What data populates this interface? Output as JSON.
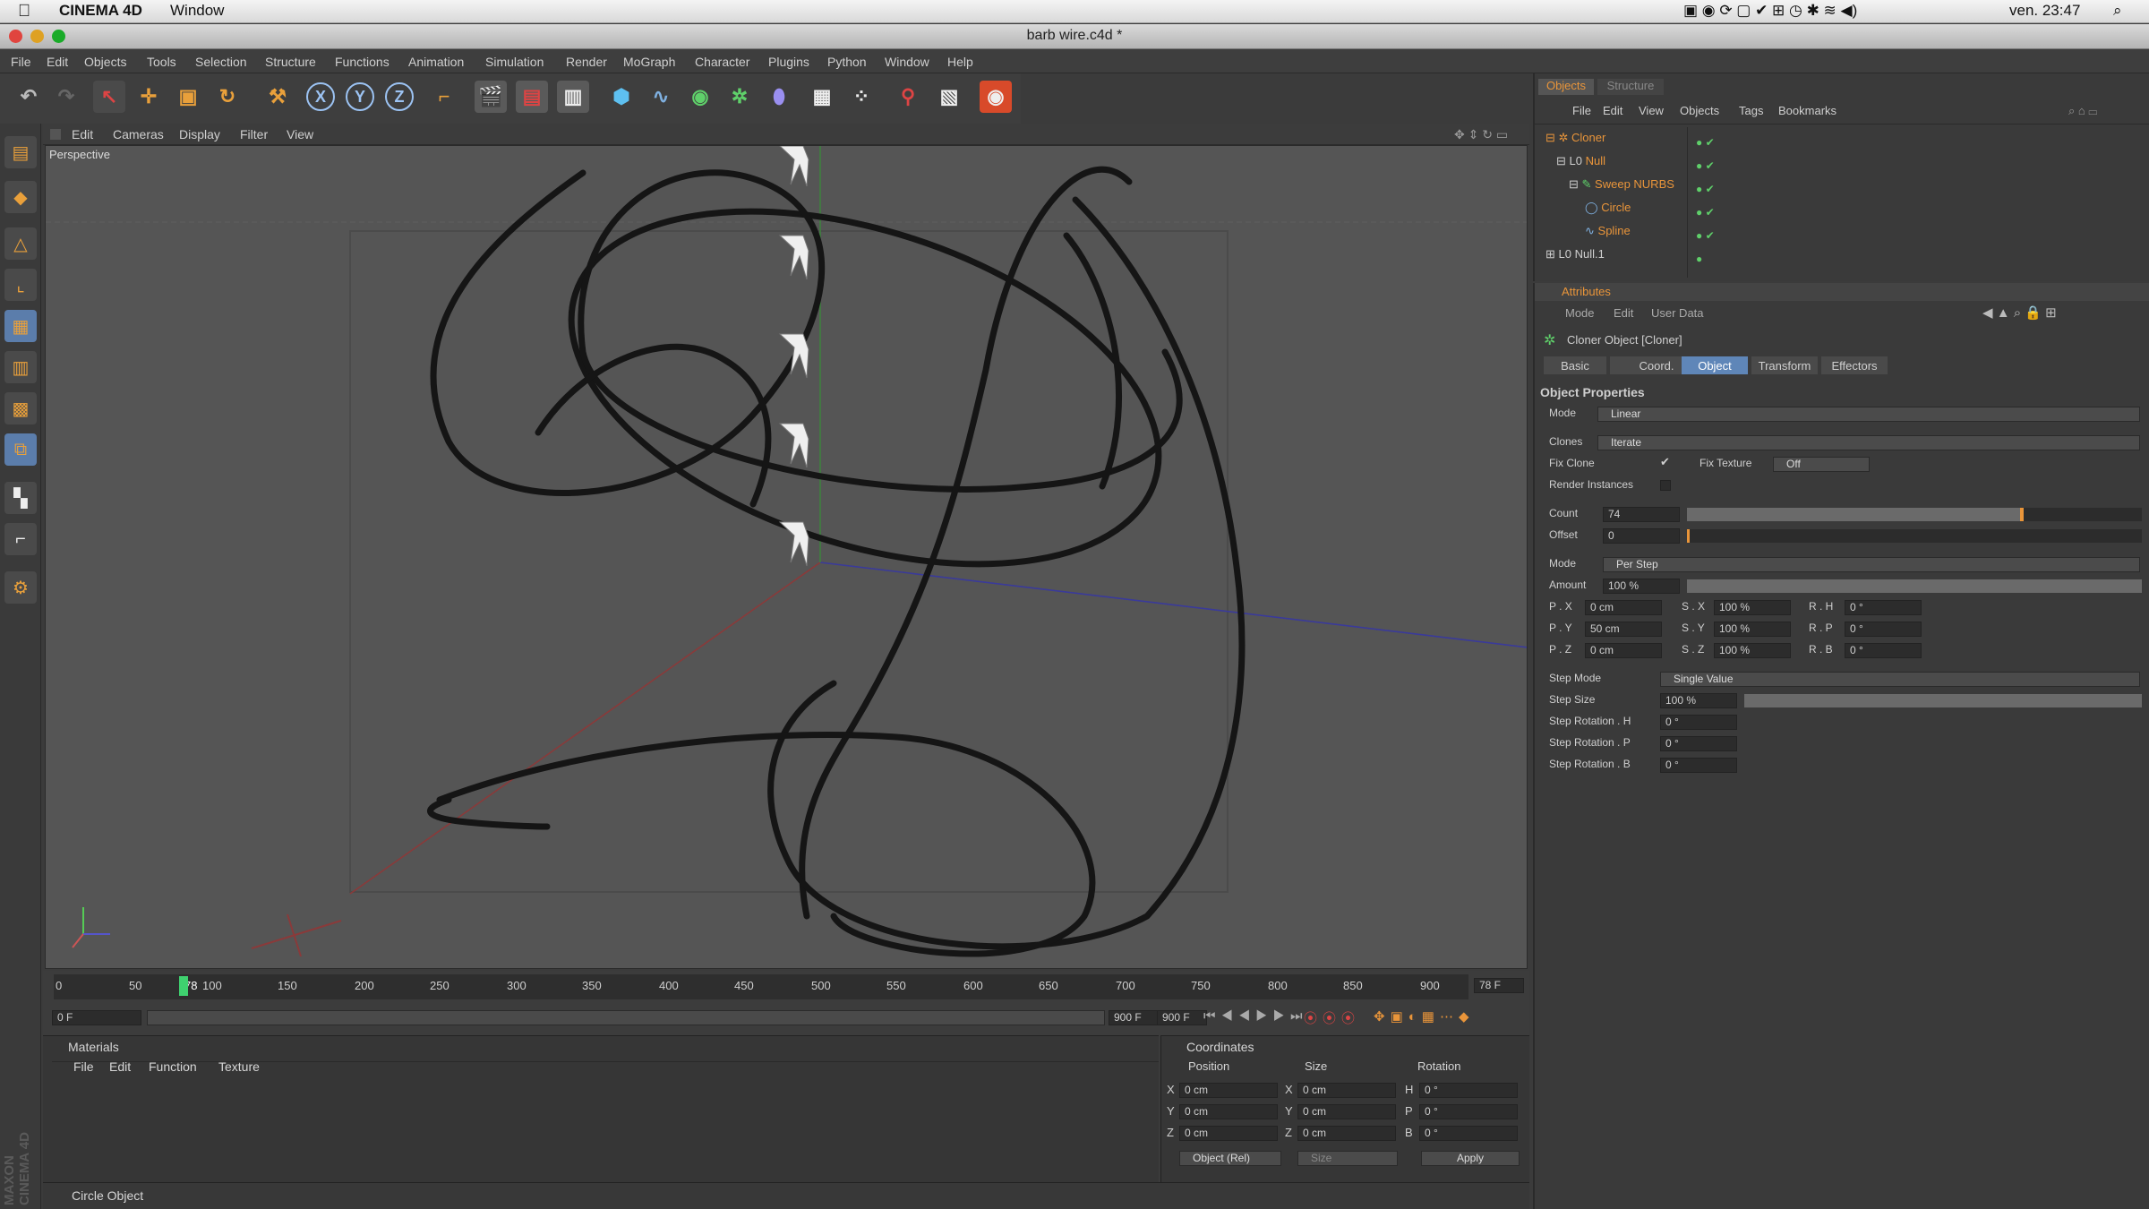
{
  "mac": {
    "app_name": "CINEMA 4D",
    "window_menu": "Window",
    "clock": "ven. 23:47"
  },
  "window": {
    "title": "barb wire.c4d *"
  },
  "menu": {
    "items": [
      "File",
      "Edit",
      "Objects",
      "Tools",
      "Selection",
      "Structure",
      "Functions",
      "Animation",
      "Simulation",
      "Render",
      "MoGraph",
      "Character",
      "Plugins",
      "Python",
      "Window",
      "Help"
    ]
  },
  "viewport": {
    "menu": [
      "Edit",
      "Cameras",
      "Display",
      "Filter",
      "View"
    ],
    "label": "Perspective"
  },
  "timeline": {
    "ticks": [
      "0",
      "50",
      "78",
      "100",
      "150",
      "200",
      "250",
      "300",
      "350",
      "400",
      "450",
      "500",
      "550",
      "600",
      "650",
      "700",
      "750",
      "800",
      "850",
      "900"
    ],
    "current_frame": "78 F",
    "start_field": "0 F",
    "end_field": "900 F",
    "end_field2": "900 F",
    "playhead_frame": 78,
    "max_frame": 900
  },
  "materials": {
    "title": "Materials",
    "menu": [
      "File",
      "Edit",
      "Function",
      "Texture"
    ]
  },
  "coordinates": {
    "title": "Coordinates",
    "headers": [
      "Position",
      "Size",
      "Rotation"
    ],
    "rows": [
      {
        "axis": "X",
        "pos": "0 cm",
        "size_axis": "X",
        "size": "0 cm",
        "rot_axis": "H",
        "rot": "0 °"
      },
      {
        "axis": "Y",
        "pos": "0 cm",
        "size_axis": "Y",
        "size": "0 cm",
        "rot_axis": "P",
        "rot": "0 °"
      },
      {
        "axis": "Z",
        "pos": "0 cm",
        "size_axis": "Z",
        "size": "0 cm",
        "rot_axis": "B",
        "rot": "0 °"
      }
    ],
    "mode": "Object (Rel)",
    "size_mode": "Size",
    "apply": "Apply"
  },
  "status": {
    "text": "Circle Object"
  },
  "maxon_logo": "MAXON CINEMA 4D",
  "objects": {
    "tabs": [
      "Objects",
      "Structure"
    ],
    "menu": [
      "File",
      "Edit",
      "View",
      "Objects",
      "Tags",
      "Bookmarks"
    ],
    "tree": [
      {
        "name": "Cloner",
        "level": 0,
        "color": "#e9953a"
      },
      {
        "name": "Null",
        "level": 1,
        "color": "#e9953a"
      },
      {
        "name": "Sweep NURBS",
        "level": 2,
        "color": "#e9953a"
      },
      {
        "name": "Circle",
        "level": 3,
        "color": "#e9953a"
      },
      {
        "name": "Spline",
        "level": 3,
        "color": "#e9953a"
      },
      {
        "name": "Null.1",
        "level": 0,
        "color": "#cfcfcf"
      }
    ]
  },
  "attributes": {
    "title": "Attributes",
    "menu": [
      "Mode",
      "Edit",
      "User Data"
    ],
    "object_title": "Cloner Object [Cloner]",
    "tabs": [
      "Basic",
      "Coord.",
      "Object",
      "Transform",
      "Effectors"
    ],
    "active_tab": "Object",
    "section": "Object Properties",
    "mode_label": "Mode",
    "mode_value": "Linear",
    "clones_label": "Clones",
    "clones_value": "Iterate",
    "fix_clone_label": "Fix Clone",
    "fix_texture_label": "Fix Texture",
    "fix_texture_value": "Off",
    "render_instances_label": "Render Instances",
    "count_label": "Count",
    "count_value": "74",
    "count_fill": 0.74,
    "offset_label": "Offset",
    "offset_value": "0",
    "mode2_label": "Mode",
    "mode2_value": "Per Step",
    "amount_label": "Amount",
    "amount_value": "100 %",
    "transform_rows": [
      {
        "p": "P . X",
        "pv": "0 cm",
        "s": "S . X",
        "sv": "100 %",
        "r": "R . H",
        "rv": "0 °"
      },
      {
        "p": "P . Y",
        "pv": "50 cm",
        "s": "S . Y",
        "sv": "100 %",
        "r": "R . P",
        "rv": "0 °"
      },
      {
        "p": "P . Z",
        "pv": "0 cm",
        "s": "S . Z",
        "sv": "100 %",
        "r": "R . B",
        "rv": "0 °"
      }
    ],
    "step_mode_label": "Step Mode",
    "step_mode_value": "Single Value",
    "step_size_label": "Step Size",
    "step_size_value": "100 %",
    "step_rot_h_label": "Step Rotation . H",
    "step_rot_h_value": "0 °",
    "step_rot_p_label": "Step Rotation . P",
    "step_rot_p_value": "0 °",
    "step_rot_b_label": "Step Rotation . B",
    "step_rot_b_value": "0 °"
  },
  "colors": {
    "accent": "#e9953a",
    "active_tab": "#5f86b8"
  }
}
